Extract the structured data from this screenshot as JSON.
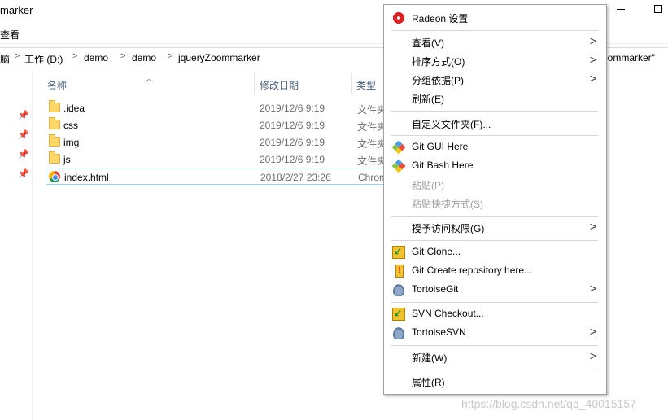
{
  "window": {
    "title": "marker",
    "menu_view": "查看"
  },
  "address": {
    "crumbs": [
      "脑",
      "工作 (D:)",
      "demo",
      "demo",
      "jqueryZoommarker"
    ],
    "separator": ">",
    "tail_text": "oommarker\""
  },
  "columns": {
    "name": "名称",
    "modified": "修改日期",
    "type": "类型"
  },
  "files": [
    {
      "name": ".idea",
      "date": "2019/12/6 9:19",
      "type": "文件夹",
      "icon": "folder-icon"
    },
    {
      "name": "css",
      "date": "2019/12/6 9:19",
      "type": "文件夹",
      "icon": "folder-icon"
    },
    {
      "name": "img",
      "date": "2019/12/6 9:19",
      "type": "文件夹",
      "icon": "folder-icon"
    },
    {
      "name": "js",
      "date": "2019/12/6 9:19",
      "type": "文件夹",
      "icon": "folder-icon"
    },
    {
      "name": "index.html",
      "date": "2018/2/27 23:26",
      "type": "Chrome",
      "icon": "chrome-icon",
      "selected": true
    }
  ],
  "context_menu": {
    "radeon": "Radeon 设置",
    "view": "查看(V)",
    "sort": "排序方式(O)",
    "group": "分组依据(P)",
    "refresh": "刷新(E)",
    "customize": "自定义文件夹(F)...",
    "git_gui": "Git GUI Here",
    "git_bash": "Git Bash Here",
    "paste": "粘贴(P)",
    "paste_shortcut": "粘贴快捷方式(S)",
    "grant_access": "授予访问权限(G)",
    "git_clone": "Git Clone...",
    "git_create": "Git Create repository here...",
    "tortoise_git": "TortoiseGit",
    "svn_checkout": "SVN Checkout...",
    "tortoise_svn": "TortoiseSVN",
    "new": "新建(W)",
    "properties": "属性(R)",
    "submenu_arrow": ">"
  },
  "watermark": "https://blog.csdn.net/qq_40015157",
  "colors": {
    "selection_border": "#99d1ff",
    "header_text": "#4c607a",
    "disabled_text": "#a0a0a0"
  }
}
